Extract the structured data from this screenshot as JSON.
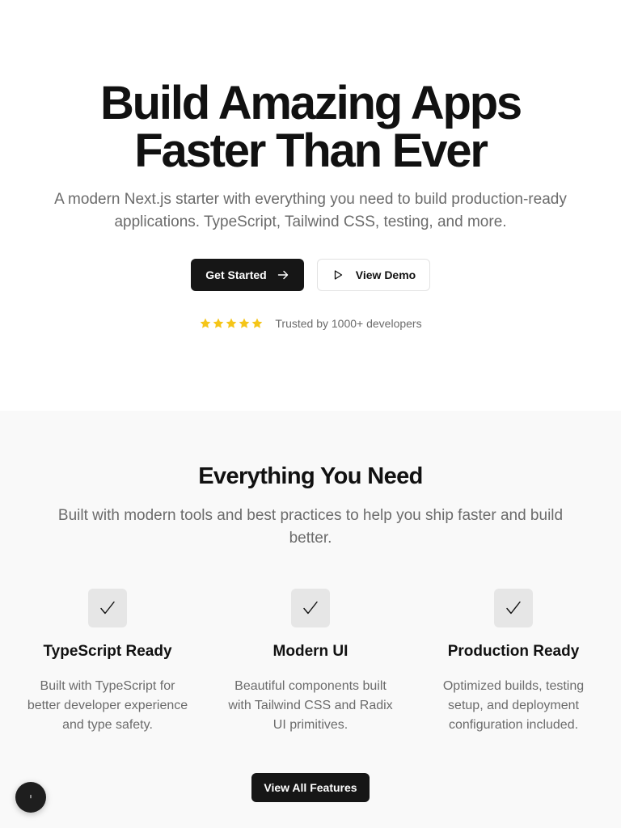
{
  "hero": {
    "title_line1": "Build Amazing Apps",
    "title_line2": "Faster Than Ever",
    "subtitle_line1": "A modern Next.js starter with everything you need to build production-ready",
    "subtitle_line2": "applications. TypeScript, Tailwind CSS, testing, and more.",
    "primary_button": "Get Started",
    "secondary_button": "View Demo",
    "trust_text": "Trusted by 1000+ developers",
    "rating": 5,
    "star_color": "#f5c518"
  },
  "features": {
    "title": "Everything You Need",
    "subtitle_line1": "Built with modern tools and best practices to help you ship faster and build",
    "subtitle_line2": "better.",
    "items": [
      {
        "title": "TypeScript Ready",
        "description": "Built with TypeScript for better developer experience and type safety.",
        "icon": "check-icon"
      },
      {
        "title": "Modern UI",
        "description": "Beautiful components built with Tailwind CSS and Radix UI primitives.",
        "icon": "check-icon"
      },
      {
        "title": "Production Ready",
        "description": "Optimized builds, testing setup, and deployment configuration included.",
        "icon": "check-icon"
      }
    ],
    "cta_button": "View All Features"
  },
  "colors": {
    "primary": "#161616",
    "muted_text": "#6b6b6b",
    "section_bg": "#f9f9f9"
  }
}
